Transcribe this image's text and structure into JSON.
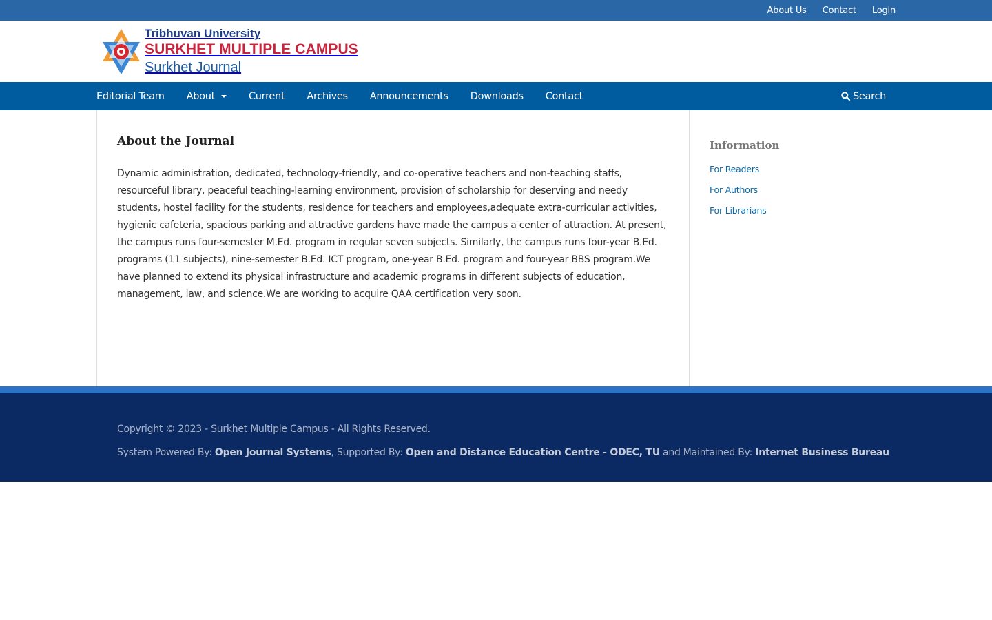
{
  "colors": {
    "top_bar": "#2a67a7",
    "main_nav": "#005b9f",
    "footer": "#0b2a63",
    "footer_strip": "#2a73c6",
    "link": "#0b6aa8",
    "logo_red": "#c8243d",
    "logo_blue": "#1d3e8a"
  },
  "user_nav": {
    "about_us": "About Us",
    "contact": "Contact",
    "login": "Login"
  },
  "logo": {
    "icon": "tribhuvan-university-emblem-icon",
    "line1": "Tribhuvan University",
    "line2": "SURKHET MULTIPLE CAMPUS",
    "line3": "Surkhet Journal"
  },
  "main_nav": {
    "editorial_team": "Editorial Team",
    "about": "About",
    "current": "Current",
    "archives": "Archives",
    "announcements": "Announcements",
    "downloads": "Downloads",
    "contact": "Contact",
    "search": "Search",
    "search_icon": "search-icon",
    "about_dropdown_icon": "caret-down-icon"
  },
  "main": {
    "title": "About the Journal",
    "body": "Dynamic administration, dedicated, technology-friendly, and co-operative teachers and non-teaching staffs, resourceful library, peaceful teaching-learning environment, provision of scholarship for deserving and needy students, hostel facility for the students, residence for teachers and employees,adequate extra-curricular activities, hygienic cafeteria, spacious parking and attractive gardens have made the campus a center of attraction. At present, the campus runs four-semester M.Ed. program in regular seven subjects. Similarly, the campus runs four-year B.Ed. programs (11 subjects), nine-semester B.Ed. ICT program, one-year B.Ed. program and four-year BBS program.We have planned to extend its physical infrastructure and academic programs in different subjects of education, management, law, and science.We are working to acquire QAA certification very soon."
  },
  "sidebar": {
    "title": "Information",
    "links": [
      "For Readers",
      "For Authors",
      "For Librarians"
    ]
  },
  "footer": {
    "copyright": "Copyright © 2023 - Surkhet Multiple Campus - All Rights Reserved.",
    "powered_prefix": "System Powered By: ",
    "powered_name": "Open Journal Systems",
    "supported_prefix": ", Supported By: ",
    "supported_name": "Open and Distance Education Centre - ODEC, TU",
    "maintained_prefix": " and Maintained By: ",
    "maintained_name": "Internet Business Bureau"
  }
}
